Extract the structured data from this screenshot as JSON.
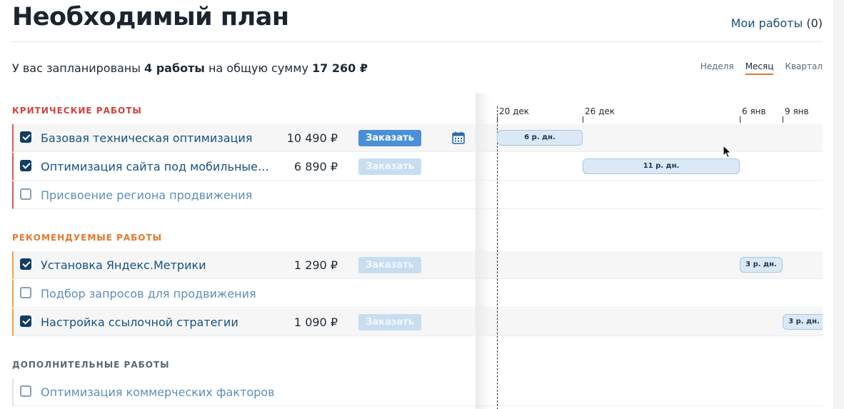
{
  "header": {
    "title": "Необходимый план",
    "my_works_link": "Мои работы",
    "my_works_count": "(0)"
  },
  "summary": {
    "prefix": "У вас запланированы",
    "works": "4 работы",
    "middle": "на общую сумму",
    "total": "17 260 ₽"
  },
  "view_tabs": [
    {
      "label": "Неделя",
      "active": false
    },
    {
      "label": "Месяц",
      "active": true
    },
    {
      "label": "Квартал",
      "active": false
    }
  ],
  "sections": {
    "critical": {
      "title": "КРИТИЧЕСКИЕ РАБОТЫ",
      "rows": [
        {
          "title": "Базовая техническая оптимизация",
          "price": "10 490 ₽",
          "button": "Заказать",
          "checked": true,
          "bar": "6 р. дн."
        },
        {
          "title": "Оптимизация сайта под мобильные…",
          "price": "6 890 ₽",
          "button": "Заказать",
          "checked": true,
          "bar": "11 р. дн."
        },
        {
          "title": "Присвоение региона продвижения",
          "checked": false
        }
      ]
    },
    "recommended": {
      "title": "РЕКОМЕНДУЕМЫЕ РАБОТЫ",
      "rows": [
        {
          "title": "Установка Яндекс.Метрики",
          "price": "1 290 ₽",
          "button": "Заказать",
          "checked": true,
          "bar": "3 р. дн."
        },
        {
          "title": "Подбор запросов для продвижения",
          "checked": false
        },
        {
          "title": "Настройка ссылочной стратегии",
          "price": "1 090 ₽",
          "button": "Заказать",
          "checked": true,
          "bar": "3 р. дн."
        }
      ]
    },
    "additional": {
      "title": "ДОПОЛНИТЕЛЬНЫЕ РАБОТЫ",
      "rows": [
        {
          "title": "Оптимизация коммерческих факторов",
          "checked": false
        }
      ]
    }
  },
  "timeline": {
    "dates": [
      "20 дек",
      "26 дек",
      "6 янв",
      "9 янв"
    ]
  },
  "icons": {
    "calendar": "calendar-icon",
    "cursor": "mouse-cursor-icon"
  },
  "colors": {
    "critical": "#d0433d",
    "recommended": "#e07a2f",
    "accent": "#4a90d9",
    "link": "#15507a"
  }
}
